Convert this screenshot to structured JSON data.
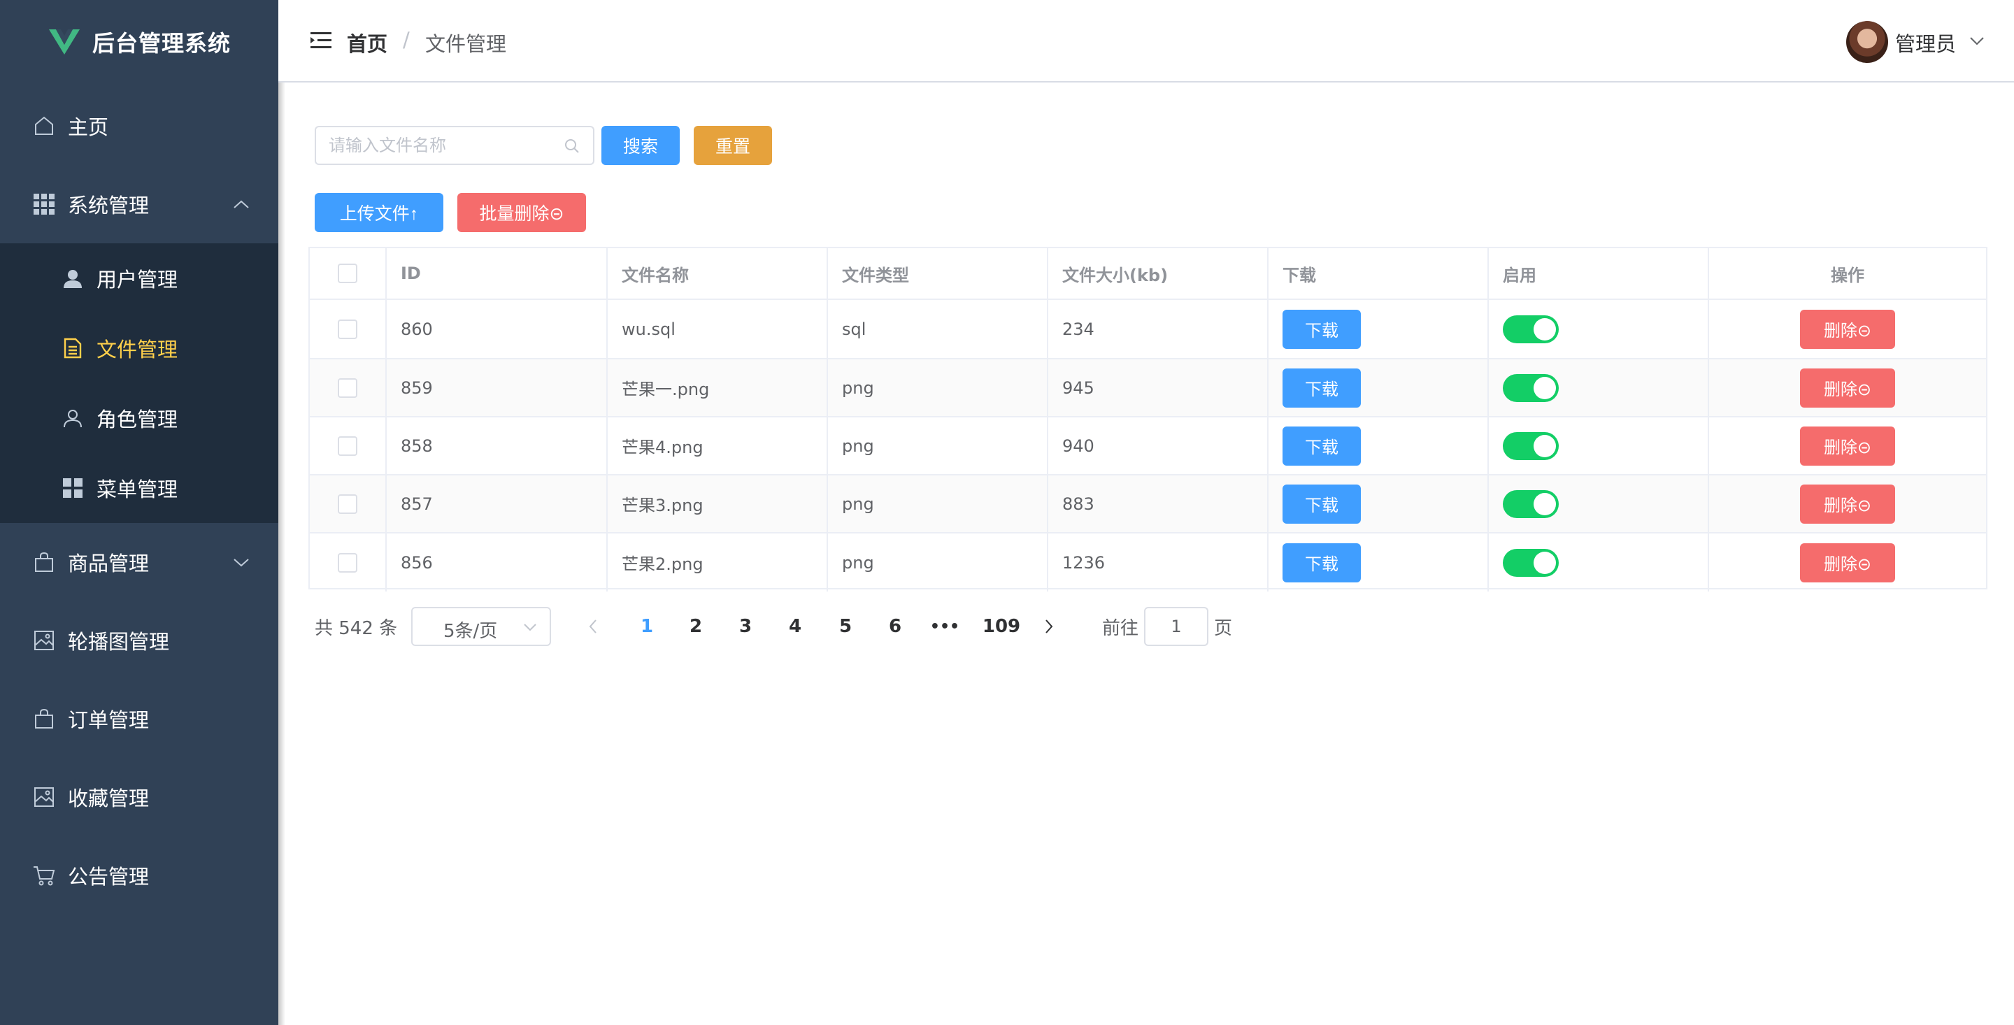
{
  "app": {
    "title": "后台管理系统"
  },
  "sidebar": {
    "items": [
      {
        "label": "主页",
        "icon": "home-icon"
      },
      {
        "label": "系统管理",
        "icon": "grid-icon",
        "expanded": true
      },
      {
        "label": "用户管理",
        "icon": "user-filled-icon"
      },
      {
        "label": "文件管理",
        "icon": "document-icon",
        "active": true
      },
      {
        "label": "角色管理",
        "icon": "user-outline-icon"
      },
      {
        "label": "菜单管理",
        "icon": "menu-grid-icon"
      },
      {
        "label": "商品管理",
        "icon": "shopping-bag-icon",
        "expanded": false
      },
      {
        "label": "轮播图管理",
        "icon": "picture-icon"
      },
      {
        "label": "订单管理",
        "icon": "shopping-bag-icon"
      },
      {
        "label": "收藏管理",
        "icon": "picture-icon"
      },
      {
        "label": "公告管理",
        "icon": "cart-icon"
      }
    ]
  },
  "header": {
    "breadcrumb": {
      "home": "首页",
      "separator": "/",
      "current": "文件管理"
    },
    "user": {
      "name": "管理员"
    }
  },
  "toolbar": {
    "search_placeholder": "请输入文件名称",
    "search_label": "搜索",
    "reset_label": "重置",
    "upload_label": "上传文件↑",
    "batch_delete_label": "批量删除⊝"
  },
  "table": {
    "columns": [
      "ID",
      "文件名称",
      "文件类型",
      "文件大小(kb)",
      "下载",
      "启用",
      "操作"
    ],
    "rows": [
      {
        "id": "860",
        "name": "wu.sql",
        "type": "sql",
        "size": "234",
        "download": "下载",
        "enabled": true,
        "action": "删除⊝"
      },
      {
        "id": "859",
        "name": "芒果一.png",
        "type": "png",
        "size": "945",
        "download": "下载",
        "enabled": true,
        "action": "删除⊝"
      },
      {
        "id": "858",
        "name": "芒果4.png",
        "type": "png",
        "size": "940",
        "download": "下载",
        "enabled": true,
        "action": "删除⊝"
      },
      {
        "id": "857",
        "name": "芒果3.png",
        "type": "png",
        "size": "883",
        "download": "下载",
        "enabled": true,
        "action": "删除⊝"
      },
      {
        "id": "856",
        "name": "芒果2.png",
        "type": "png",
        "size": "1236",
        "download": "下载",
        "enabled": true,
        "action": "删除⊝"
      }
    ]
  },
  "pagination": {
    "total_text": "共 542 条",
    "page_size": "5条/页",
    "pages": [
      "1",
      "2",
      "3",
      "4",
      "5",
      "6",
      "•••",
      "109"
    ],
    "current_page": "1",
    "goto_label": "前往",
    "goto_value": "1",
    "goto_suffix": "页"
  },
  "colors": {
    "sidebar_bg": "#304156",
    "submenu_bg": "#1f2d3d",
    "active_menu": "#ffd04b",
    "primary": "#409eff",
    "warning": "#e6a23c",
    "danger": "#f56c6c",
    "success": "#13ce66"
  }
}
